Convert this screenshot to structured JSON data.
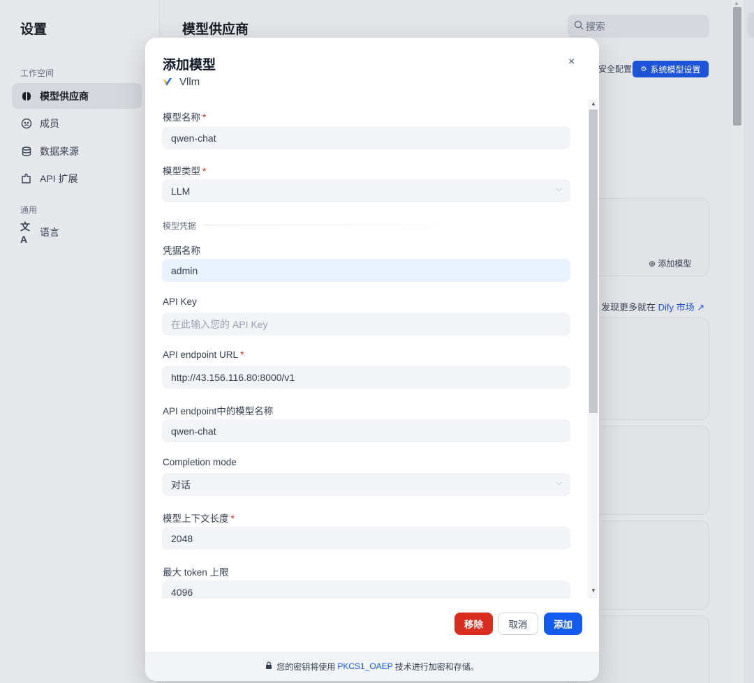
{
  "sidebar": {
    "title": "设置",
    "workspace_section": "工作空间",
    "items": [
      {
        "label": "模型供应商",
        "icon": "brain-icon"
      },
      {
        "label": "成员",
        "icon": "members-icon"
      },
      {
        "label": "数据来源",
        "icon": "database-icon"
      },
      {
        "label": "API 扩展",
        "icon": "puzzle-icon"
      }
    ],
    "general_section": "通用",
    "general_items": [
      {
        "label": "语言",
        "icon": "translate-icon"
      }
    ]
  },
  "main": {
    "page_title": "模型供应商",
    "search_placeholder": "搜索",
    "config_text": "安全配置",
    "system_model_button": "系统模型设置",
    "add_model": "添加模型",
    "discover_prefix": "发现更多就在",
    "discover_link": "Dify 市场"
  },
  "modal": {
    "title": "添加模型",
    "provider": "Vllm",
    "close_symbol": "×",
    "fields": {
      "model_name": {
        "label": "模型名称",
        "value": "qwen-chat",
        "required": "*"
      },
      "model_type": {
        "label": "模型类型",
        "value": "LLM",
        "required": "*"
      },
      "credentials_divider": "模型凭据",
      "credential_name": {
        "label": "凭据名称",
        "value": "admin"
      },
      "api_key": {
        "label": "API Key",
        "placeholder": "在此输入您的 API Key"
      },
      "endpoint_url": {
        "label": "API endpoint URL",
        "value": "http://43.156.116.80:8000/v1",
        "required": "*"
      },
      "endpoint_model_name": {
        "label": "API endpoint中的模型名称",
        "value": "qwen-chat"
      },
      "completion_mode": {
        "label": "Completion mode",
        "value": "对话"
      },
      "context_length": {
        "label": "模型上下文长度",
        "value": "2048",
        "required": "*"
      },
      "max_tokens": {
        "label": "最大 token 上限",
        "value": "4096"
      }
    },
    "buttons": {
      "remove": "移除",
      "cancel": "取消",
      "add": "添加"
    },
    "footer": {
      "prefix": "您的密钥将使用",
      "link": "PKCS1_OAEP",
      "suffix": "技术进行加密和存储。"
    }
  },
  "colors": {
    "primary": "#155aef",
    "danger": "#d92d20",
    "accent_brand_blue": "#1d53d8"
  }
}
